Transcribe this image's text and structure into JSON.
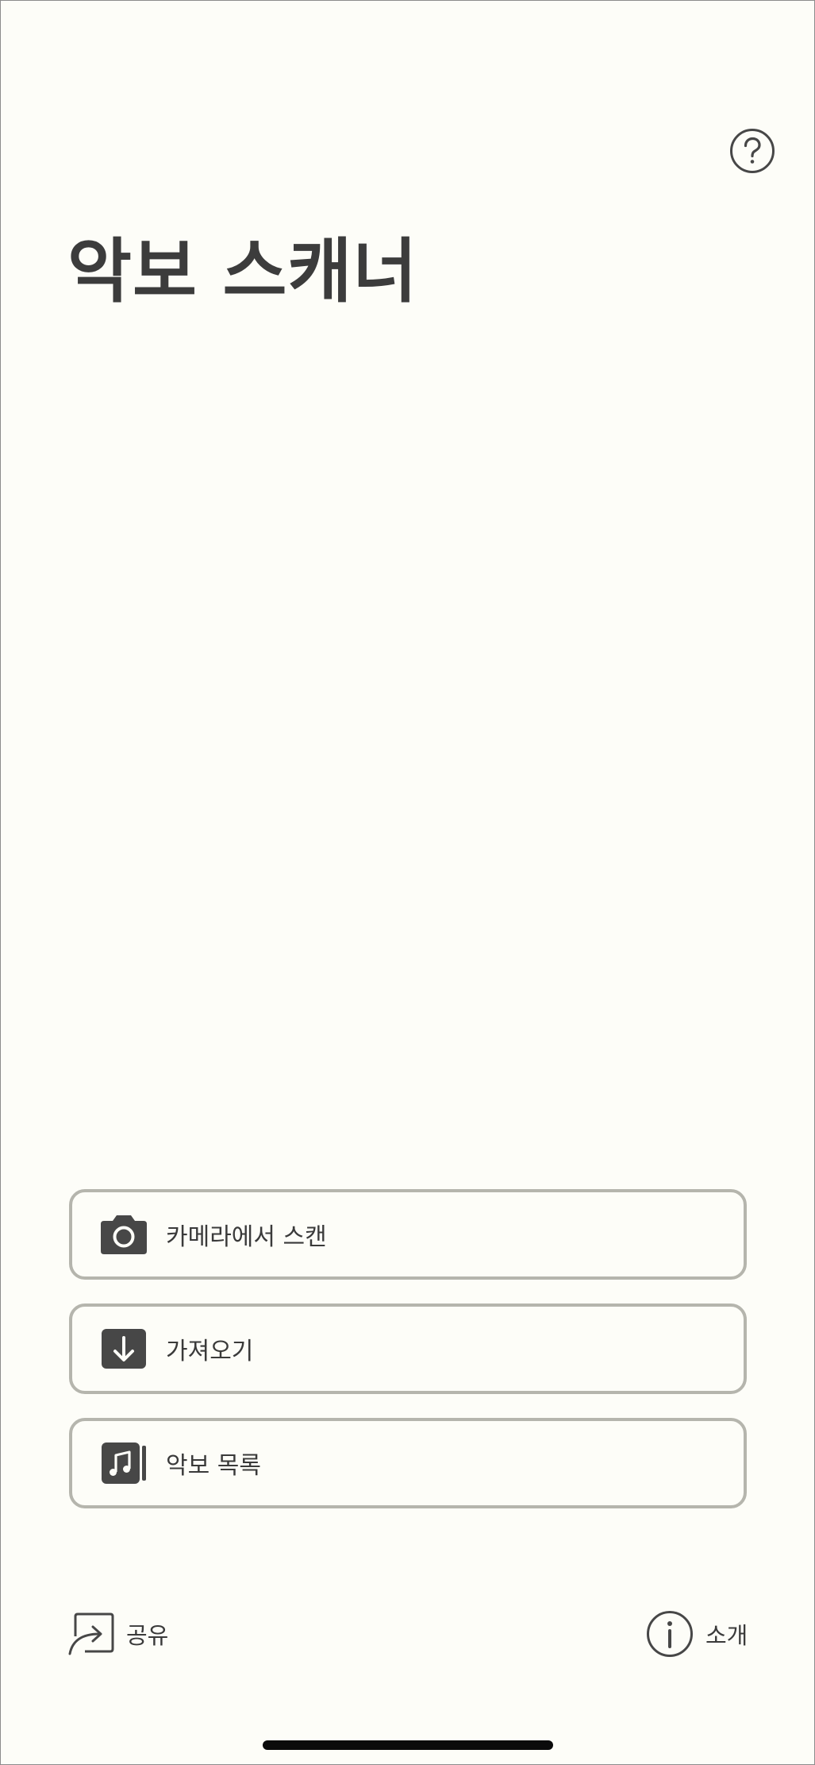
{
  "app": {
    "title": "악보 스캐너"
  },
  "header": {
    "help_icon": "question-circle-icon"
  },
  "actions": [
    {
      "label": "카메라에서 스캔",
      "icon": "camera-icon"
    },
    {
      "label": "가져오기",
      "icon": "download-icon"
    },
    {
      "label": "악보 목록",
      "icon": "music-note-icon"
    }
  ],
  "footer": {
    "share_label": "공유",
    "share_icon": "share-icon",
    "about_label": "소개",
    "about_icon": "info-icon"
  },
  "colors": {
    "background": "#fdfdf8",
    "text": "#3f3f3f",
    "button_border": "#b5b5ad",
    "icon_fill": "#474747"
  }
}
